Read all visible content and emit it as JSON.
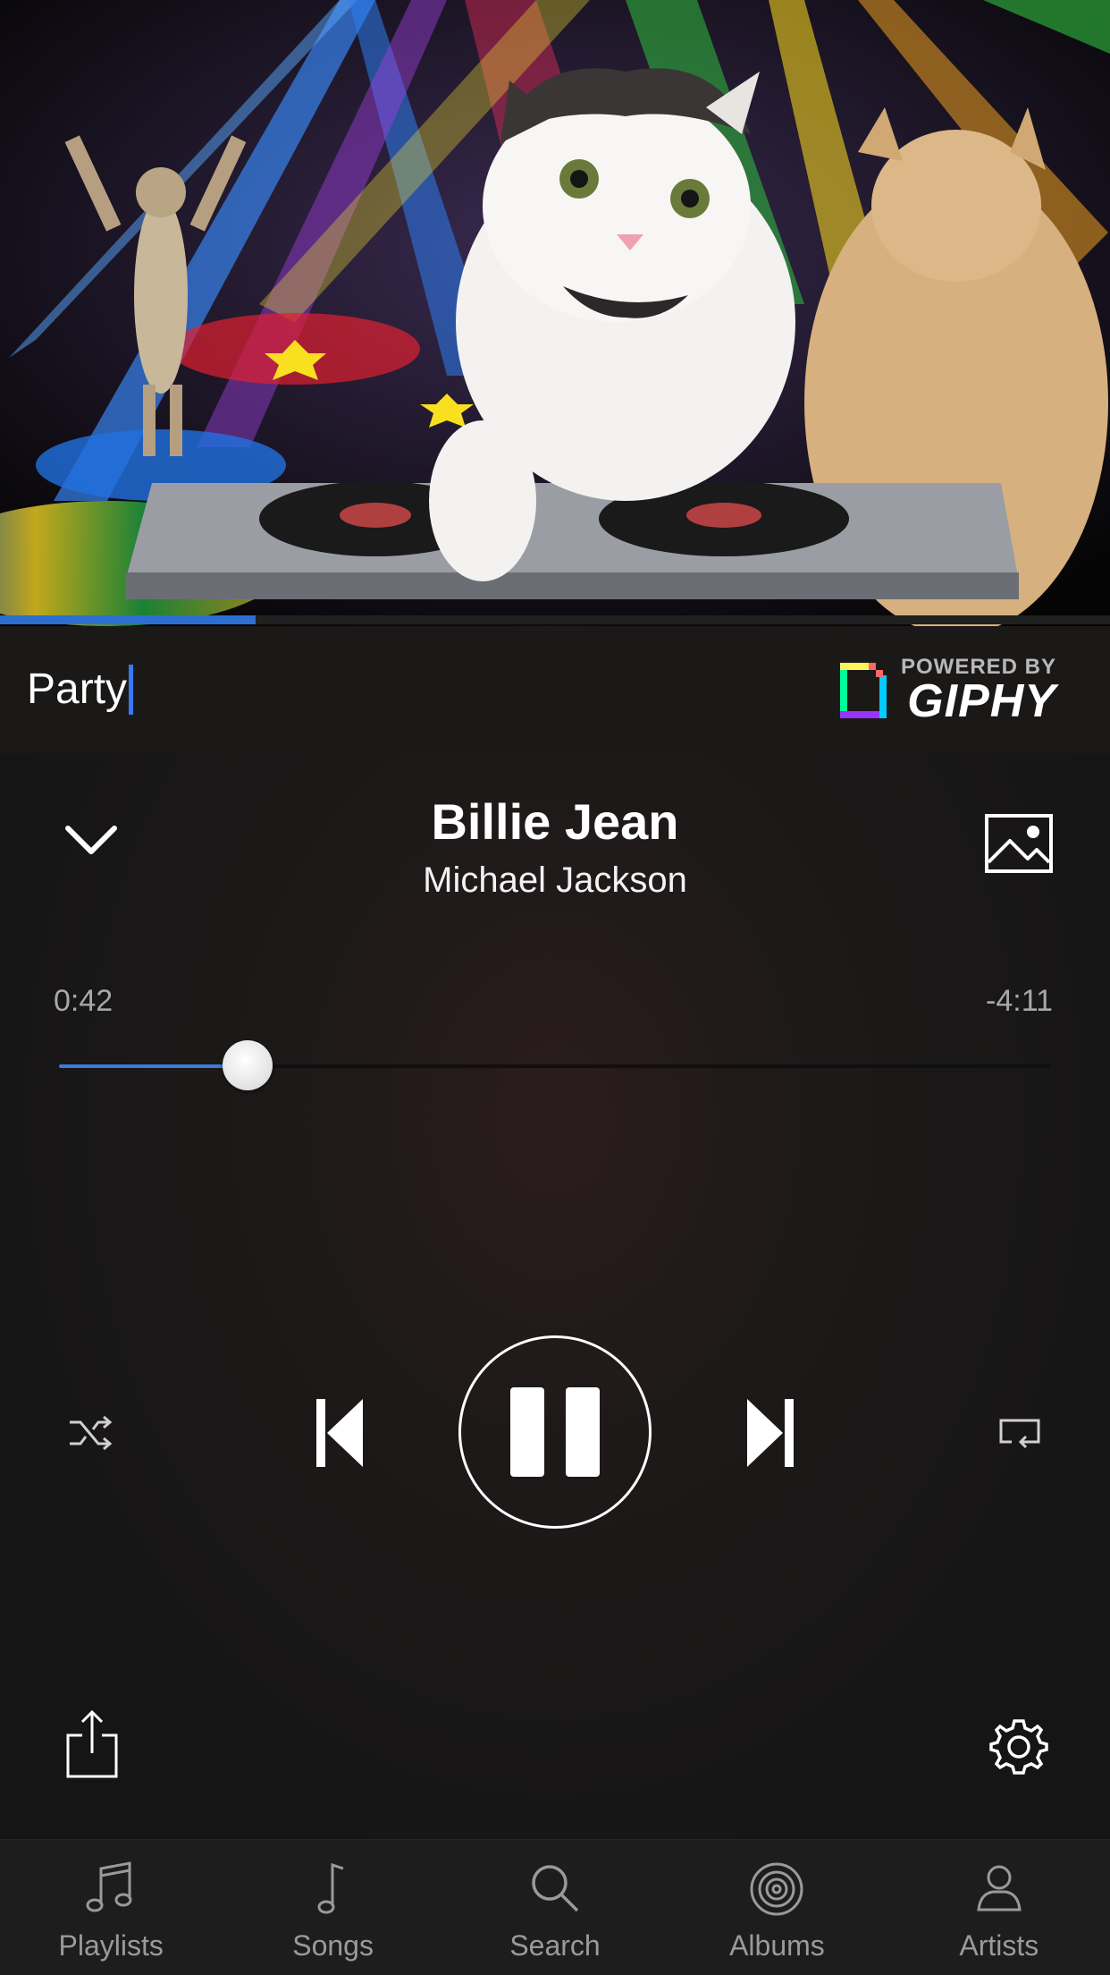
{
  "gif": {
    "progress_fraction": 0.23
  },
  "search": {
    "value": "Party"
  },
  "giphy": {
    "powered_by": "POWERED BY",
    "brand": "GIPHY"
  },
  "now_playing": {
    "title": "Billie Jean",
    "artist": "Michael Jackson",
    "elapsed": "0:42",
    "remaining": "-4:11",
    "progress_fraction": 0.19
  },
  "tabs": [
    {
      "label": "Playlists",
      "icon": "music-notes-icon"
    },
    {
      "label": "Songs",
      "icon": "music-note-icon"
    },
    {
      "label": "Search",
      "icon": "search-icon"
    },
    {
      "label": "Albums",
      "icon": "album-icon"
    },
    {
      "label": "Artists",
      "icon": "person-icon"
    }
  ],
  "colors": {
    "accent": "#3c7bd6",
    "caret": "#3a78f2",
    "background": "#151414"
  }
}
